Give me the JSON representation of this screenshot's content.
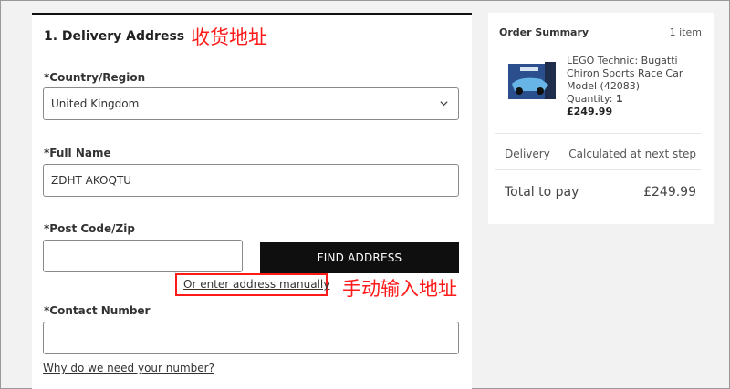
{
  "annotations": {
    "title_cn": "收货地址",
    "manual_cn": "手动输入地址"
  },
  "delivery": {
    "section_title": "1. Delivery Address",
    "country": {
      "label": "*Country/Region",
      "value": "United Kingdom",
      "icon": "chevron-down-icon"
    },
    "full_name": {
      "label": "*Full Name",
      "value": "ZDHT AKOQTU"
    },
    "post_code": {
      "label": "*Post Code/Zip",
      "value": ""
    },
    "find_address_button": "FIND ADDRESS",
    "manual_link": "Or enter address manually",
    "contact_number": {
      "label": "*Contact Number",
      "value": ""
    },
    "why_link": "Why do we need your number?"
  },
  "summary": {
    "title": "Order Summary",
    "item_count": "1 item",
    "product": {
      "name": "LEGO Technic: Bugatti Chiron Sports Race Car Model (42083)",
      "quantity_label": "Quantity:",
      "quantity": "1",
      "price": "£249.99"
    },
    "delivery_label": "Delivery",
    "delivery_value": "Calculated at next step",
    "total_label": "Total to pay",
    "total_value": "£249.99"
  },
  "colors": {
    "annotation_red": "#ff1a1a",
    "button_black": "#0f0f0f",
    "page_background": "#f2f2f2"
  }
}
